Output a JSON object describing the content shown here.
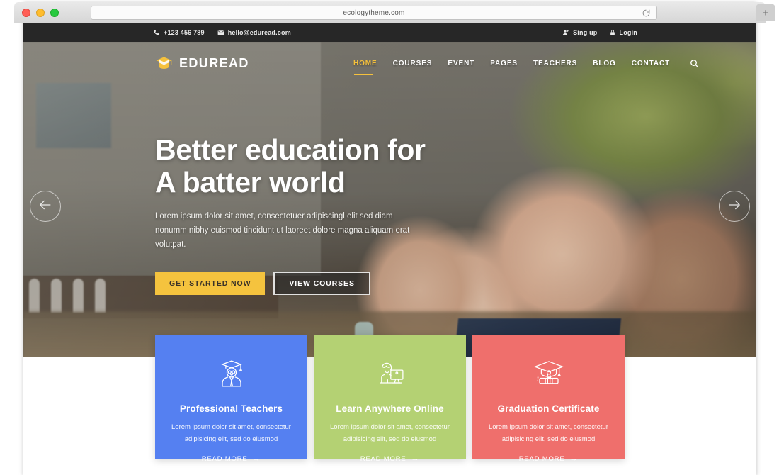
{
  "browser": {
    "url": "ecologytheme.com",
    "reload_icon": "reload-icon",
    "new_tab_label": "+",
    "traffic_lights": [
      "close",
      "minimize",
      "zoom"
    ]
  },
  "topbar": {
    "phone": "+123 456 789",
    "phone_icon": "phone-icon",
    "email": "hello@eduread.com",
    "email_icon": "envelope-icon",
    "signup_label": "Sing up",
    "signup_icon": "user-add-icon",
    "login_label": "Login",
    "login_icon": "lock-icon"
  },
  "header": {
    "logo_text": "EDUREAD",
    "logo_icon": "graduation-cap-icon",
    "nav": [
      {
        "label": "HOME",
        "active": true
      },
      {
        "label": "COURSES",
        "active": false
      },
      {
        "label": "EVENT",
        "active": false
      },
      {
        "label": "PAGES",
        "active": false
      },
      {
        "label": "TEACHERS",
        "active": false
      },
      {
        "label": "BLOG",
        "active": false
      },
      {
        "label": "CONTACT",
        "active": false
      }
    ],
    "search_icon": "search-icon",
    "accent_color": "#f5c13d"
  },
  "hero": {
    "title_line1": "Better education for",
    "title_line2": "A batter world",
    "description": "Lorem ipsum dolor sit amet, consectetuer adipiscingl elit sed diam nonumm nibhy euismod tincidunt ut laoreet dolore magna aliquam erat volutpat.",
    "primary_button": "GET STARTED NOW",
    "secondary_button": "VIEW COURSES",
    "primary_button_color": "#f5c33e",
    "prev_arrow_icon": "arrow-left-icon",
    "next_arrow_icon": "arrow-right-icon"
  },
  "cards": [
    {
      "icon": "professor-icon",
      "title": "Professional Teachers",
      "description": "Lorem ipsum dolor sit amet, consectetur adipisicing elit, sed do eiusmod",
      "link_label": "READ MORE",
      "link_arrow": "→",
      "color": "#5580f1"
    },
    {
      "icon": "person-computer-icon",
      "title": "Learn Anywhere Online",
      "description": "Lorem ipsum dolor sit amet, consectetur adipisicing elit, sed do eiusmod",
      "link_label": "READ MORE",
      "link_arrow": "→",
      "color": "#b4d173"
    },
    {
      "icon": "certificate-cap-icon",
      "title": "Graduation Certificate",
      "description": "Lorem ipsum dolor sit amet, consectetur adipisicing elit, sed do eiusmod",
      "link_label": "READ MORE",
      "link_arrow": "→",
      "color": "#ef6f6c"
    }
  ]
}
